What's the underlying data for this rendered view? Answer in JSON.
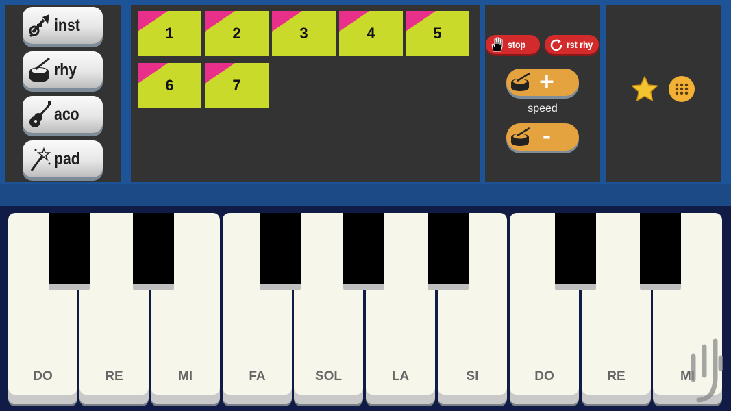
{
  "sidebar": {
    "items": [
      {
        "label": "inst",
        "icon": "trumpet-icon"
      },
      {
        "label": "rhy",
        "icon": "drum-icon"
      },
      {
        "label": "aco",
        "icon": "guitar-icon"
      },
      {
        "label": "pad",
        "icon": "magic-wand-icon"
      }
    ]
  },
  "rhythms": {
    "tiles": [
      "1",
      "2",
      "3",
      "4",
      "5",
      "6",
      "7"
    ]
  },
  "controls": {
    "stop_label": "stop",
    "reset_label": "rst rhy",
    "speed_label": "speed",
    "plus_symbol": "+",
    "minus_symbol": "-"
  },
  "extras": {
    "icons": [
      "star-icon",
      "grid-menu-icon"
    ]
  },
  "keyboard": {
    "white_keys": [
      "DO",
      "RE",
      "MI",
      "FA",
      "SOL",
      "LA",
      "SI",
      "DO",
      "RE",
      "MI"
    ],
    "black_key_count": 7
  },
  "colors": {
    "frame_blue": "#1d5497",
    "panel": "#333333",
    "tile_green": "#c9da2b",
    "tile_corner_pink": "#e8308a",
    "red_button": "#d32b2b",
    "speed_orange": "#e4a33e",
    "star_gold": "#f4c430"
  }
}
